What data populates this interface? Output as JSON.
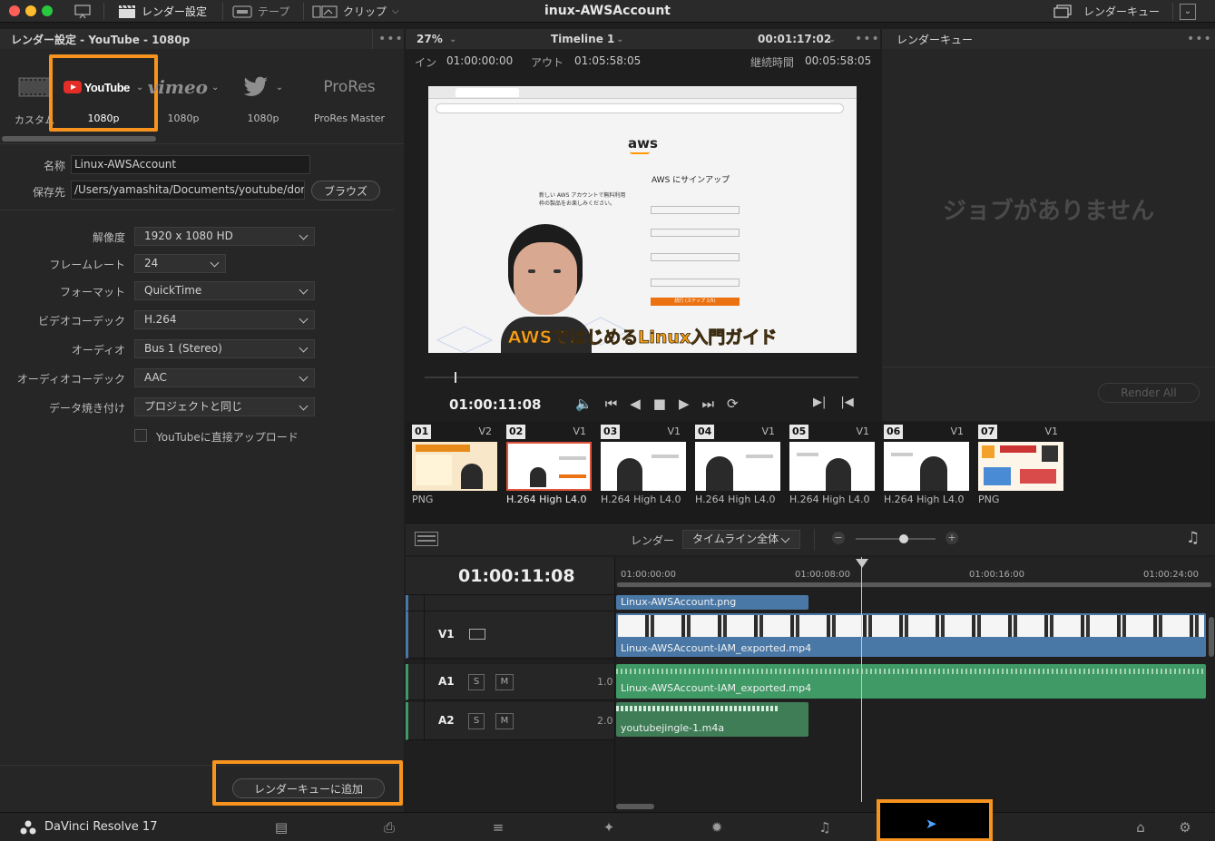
{
  "topbar": {
    "render_settings_label": "レンダー設定",
    "tape_label": "テープ",
    "clip_label": "クリップ",
    "app_title": "inux-AWSAccount",
    "render_queue_label": "レンダーキュー"
  },
  "render_settings": {
    "panel_title": "レンダー設定 - YouTube - 1080p",
    "presets": [
      {
        "logo": "",
        "label": "カスタム"
      },
      {
        "logo": "YouTube",
        "label": "1080p"
      },
      {
        "logo": "vimeo",
        "label": "1080p"
      },
      {
        "logo": "twitter",
        "label": "1080p"
      },
      {
        "logo": "ProRes",
        "label": "ProRes Master"
      }
    ],
    "name_label": "名称",
    "name_value": "Linux-AWSAccount",
    "location_label": "保存先",
    "location_value": "/Users/yamashita/Documents/youtube/done",
    "browse_label": "ブラウズ",
    "resolution_label": "解像度",
    "resolution_value": "1920 x 1080 HD",
    "framerate_label": "フレームレート",
    "framerate_value": "24",
    "format_label": "フォーマット",
    "format_value": "QuickTime",
    "video_codec_label": "ビデオコーデック",
    "video_codec_value": "H.264",
    "audio_label": "オーディオ",
    "audio_value": "Bus 1 (Stereo)",
    "audio_codec_label": "オーディオコーデック",
    "audio_codec_value": "AAC",
    "burn_in_label": "データ焼き付け",
    "burn_in_value": "プロジェクトと同じ",
    "upload_label": "YouTubeに直接アップロード",
    "add_queue_label": "レンダーキューに追加"
  },
  "viewer": {
    "zoom": "27%",
    "timeline_name": "Timeline 1",
    "timecode_header": "00:01:17:02",
    "in_label": "イン",
    "in_value": "01:00:00:00",
    "out_label": "アウト",
    "out_value": "01:05:58:05",
    "duration_label": "継続時間",
    "duration_value": "00:05:58:05",
    "current_timecode": "01:00:11:08",
    "caption": "AWSではじめるLinux入門ガイド",
    "page_heading": "AWS にサインアップ",
    "signup_button": "続行 (ステップ 1/5)",
    "aws_logo": "aws",
    "page_lead": "新しい AWS アカウントで無料利用枠の製品をお楽しみください。"
  },
  "render_queue": {
    "title": "レンダーキュー",
    "empty_text": "ジョブがありません",
    "render_all_label": "Render All"
  },
  "clips": [
    {
      "num": "01",
      "track": "V2",
      "codec": "PNG"
    },
    {
      "num": "02",
      "track": "V1",
      "codec": "H.264 High L4.0"
    },
    {
      "num": "03",
      "track": "V1",
      "codec": "H.264 High L4.0"
    },
    {
      "num": "04",
      "track": "V1",
      "codec": "H.264 High L4.0"
    },
    {
      "num": "05",
      "track": "V1",
      "codec": "H.264 High L4.0"
    },
    {
      "num": "06",
      "track": "V1",
      "codec": "H.264 High L4.0"
    },
    {
      "num": "07",
      "track": "V1",
      "codec": "PNG"
    }
  ],
  "timeline": {
    "render_label": "レンダー",
    "render_range": "タイムライン全体",
    "timecode": "01:00:11:08",
    "ruler": [
      "01:00:00:00",
      "01:00:08:00",
      "01:00:16:00",
      "01:00:24:00"
    ],
    "tracks": {
      "v1": "V1",
      "a1": "A1",
      "a2": "A2",
      "a1_level": "1.0",
      "a2_level": "2.0",
      "solo": "S",
      "mute": "M"
    },
    "clip_png": "Linux-AWSAccount.png",
    "clip_video": "Linux-AWSAccount-IAM_exported.mp4",
    "clip_audio": "Linux-AWSAccount-IAM_exported.mp4",
    "clip_jingle": "youtubejingle-1.m4a"
  },
  "bottombar": {
    "app_name": "DaVinci Resolve 17"
  },
  "colors": {
    "highlight": "#f7931e",
    "video_clip": "#4a78a6",
    "audio_clip": "#3f9a66",
    "youtube_red": "#e52d27"
  }
}
